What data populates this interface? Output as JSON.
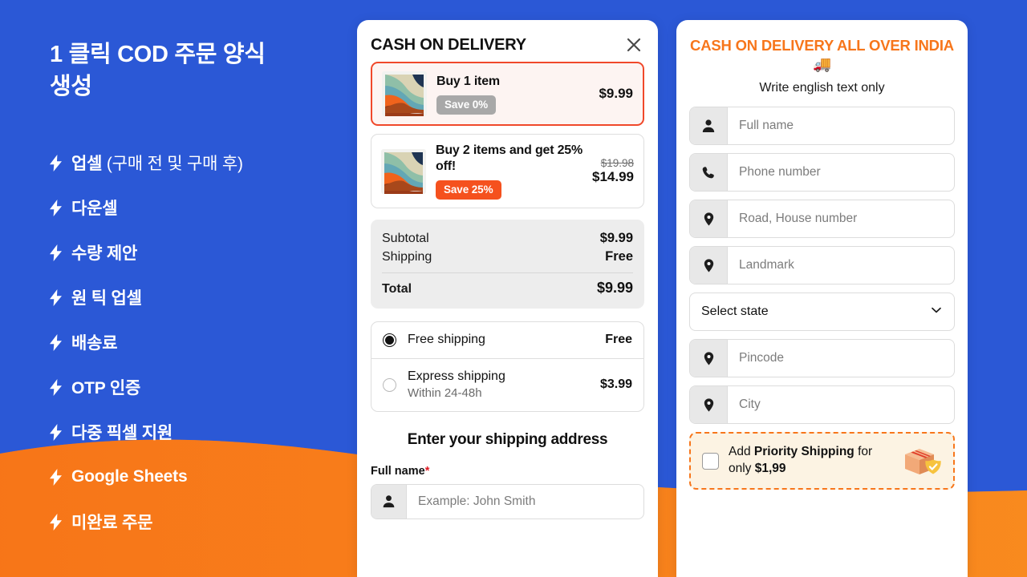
{
  "colors": {
    "brand_blue": "#2B58D6",
    "brand_orange": "#F7821B",
    "accent_orange_red": "#F0482A",
    "cod_title_orange": "#F7761B",
    "badge_gray": "#A8A8A8",
    "badge_orange": "#F5511E"
  },
  "promo": {
    "title": "1 클릭 COD 주문 양식\n생성",
    "items": [
      {
        "icon": "bolt-icon",
        "label": "업셀 ",
        "sub": "(구매 전 및 구매 후)"
      },
      {
        "icon": "bolt-icon",
        "label": "다운셀",
        "sub": ""
      },
      {
        "icon": "bolt-icon",
        "label": "수량 제안",
        "sub": ""
      },
      {
        "icon": "bolt-icon",
        "label": "원 틱 업셀",
        "sub": ""
      },
      {
        "icon": "bolt-icon",
        "label": "배송료",
        "sub": ""
      },
      {
        "icon": "bolt-icon",
        "label": "OTP 인증",
        "sub": ""
      },
      {
        "icon": "bolt-icon",
        "label": "다중 픽셀 지원",
        "sub": ""
      },
      {
        "icon": "bolt-icon",
        "label": "Google Sheets",
        "sub": ""
      },
      {
        "icon": "bolt-icon",
        "label": "미완료 주문",
        "sub": ""
      }
    ]
  },
  "checkout": {
    "title": "CASH ON DELIVERY",
    "close_icon": "close-icon",
    "offers": [
      {
        "name": "Buy 1 item",
        "badge": "Save 0%",
        "badge_style": "gray",
        "price": "$9.99",
        "compare_at": "",
        "selected": true,
        "thumb": "pillow-product-image"
      },
      {
        "name": "Buy 2 items and get 25% off!",
        "badge": "Save 25%",
        "badge_style": "orange",
        "price": "$14.99",
        "compare_at": "$19.98",
        "selected": false,
        "thumb": "pillow-product-image"
      }
    ],
    "totals": {
      "subtotal_label": "Subtotal",
      "subtotal_value": "$9.99",
      "shipping_label": "Shipping",
      "shipping_value": "Free",
      "total_label": "Total",
      "total_value": "$9.99"
    },
    "shipping_options": [
      {
        "name": "Free shipping",
        "sub": "",
        "price": "Free",
        "selected": true
      },
      {
        "name": "Express shipping",
        "sub": "Within 24-48h",
        "price": "$3.99",
        "selected": false
      }
    ],
    "address_heading": "Enter your shipping address",
    "fullname_label": "Full name",
    "fullname_required_mark": "*",
    "fullname_placeholder": "Example: John Smith",
    "fullname_value": ""
  },
  "cod": {
    "title": "CASH ON DELIVERY ALL OVER INDIA 🚚",
    "subtitle": "Write english text only",
    "fields": [
      {
        "icon": "person-icon",
        "placeholder": "Full name",
        "value": ""
      },
      {
        "icon": "phone-icon",
        "placeholder": "Phone number",
        "value": ""
      },
      {
        "icon": "location-pin-icon",
        "placeholder": "Road, House number",
        "value": ""
      },
      {
        "icon": "location-pin-icon",
        "placeholder": "Landmark",
        "value": ""
      }
    ],
    "state_select": {
      "value": "Select state",
      "icon": "chevron-down-icon"
    },
    "fields2": [
      {
        "icon": "location-pin-icon",
        "placeholder": "Pincode",
        "value": ""
      },
      {
        "icon": "location-pin-icon",
        "placeholder": "City",
        "value": ""
      }
    ],
    "priority": {
      "text_lead": "Add ",
      "text_bold": "Priority Shipping",
      "text_mid": " for only ",
      "text_price": "$1,99",
      "icon": "package-shield-icon",
      "checked": false
    }
  }
}
